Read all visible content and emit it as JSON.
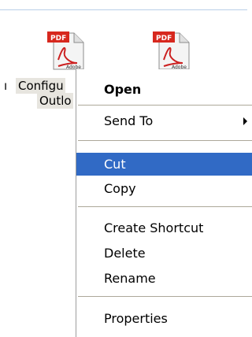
{
  "desktop": {
    "files": [
      {
        "icon": "pdf-file-icon",
        "badge": "PDF",
        "brand": "Adobe",
        "caption_line1": "Configu",
        "caption_line2": "Outlo"
      },
      {
        "icon": "pdf-file-icon",
        "badge": "PDF",
        "brand": "Adobe"
      }
    ],
    "caption_bullet": "ı"
  },
  "context_menu": {
    "items": [
      {
        "label": "Open",
        "bold": true
      },
      {
        "label": "Send To",
        "has_submenu": true
      },
      {
        "label": "Cut",
        "selected": true
      },
      {
        "label": "Copy"
      },
      {
        "label": "Create Shortcut"
      },
      {
        "label": "Delete"
      },
      {
        "label": "Rename"
      },
      {
        "label": "Properties"
      }
    ]
  },
  "colors": {
    "selection": "#316ac5",
    "pdf_badge": "#d7281e",
    "caption_bg": "#e7e5df"
  }
}
